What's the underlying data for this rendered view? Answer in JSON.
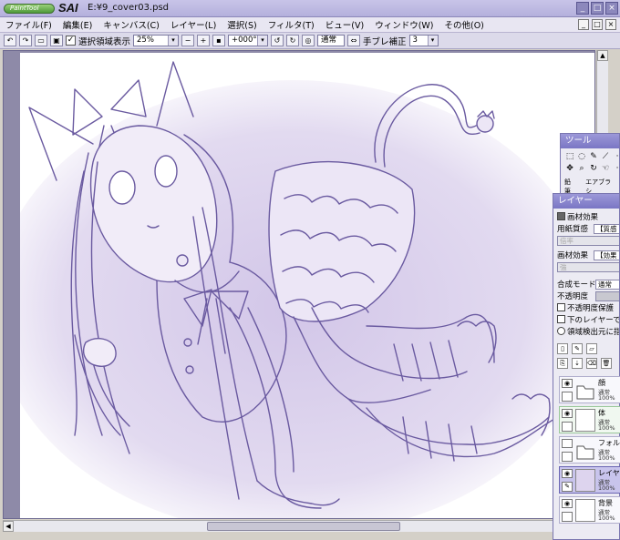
{
  "window": {
    "logo_paint": "PaintTool",
    "logo_sai": "SAI",
    "title": "E:¥9_cover03.psd"
  },
  "menu": [
    "ファイル(F)",
    "編集(E)",
    "キャンバス(C)",
    "レイヤー(L)",
    "選択(S)",
    "フィルタ(T)",
    "ビュー(V)",
    "ウィンドウ(W)",
    "その他(O)"
  ],
  "toolbar": {
    "selection_label": "選択領域表示",
    "zoom": "25%",
    "rotation": "+000°",
    "blend": "通常",
    "stabilizer_label": "手ブレ補正",
    "stabilizer_value": "3"
  },
  "tool_panel": {
    "title": "ツール",
    "tabs": [
      "鉛筆",
      "エアブラシ"
    ]
  },
  "layer_panel": {
    "title": "レイヤー",
    "texture_section": "画材効果",
    "paper_label": "用紙質感",
    "paper_value": "【質感",
    "paper_sub": "倍率",
    "effect_label": "画材効果",
    "effect_value": "【効果",
    "effect_sub": "強",
    "blend_label": "合成モード",
    "blend_value": "通常",
    "opacity_label": "不透明度",
    "check_protect": "不透明度保護",
    "check_clip": "下のレイヤーでクリッピング",
    "check_select": "領域検出元に指定",
    "layers": [
      {
        "name": "顔",
        "mode": "通常",
        "opacity": "100%",
        "type": "folder",
        "active": false
      },
      {
        "name": "体",
        "mode": "通常",
        "opacity": "100%",
        "type": "layer",
        "active": false
      },
      {
        "name": "フォルダ",
        "mode": "通常",
        "opacity": "100%",
        "type": "folder",
        "active": false
      },
      {
        "name": "レイヤー",
        "mode": "通常",
        "opacity": "100%",
        "type": "layer",
        "active": true
      },
      {
        "name": "背景",
        "mode": "通常",
        "opacity": "100%",
        "type": "layer",
        "active": false
      }
    ]
  },
  "colors": {
    "accent": "#7a76c4",
    "line_art": "#6a5aa0",
    "shade": "#c8bce0"
  }
}
